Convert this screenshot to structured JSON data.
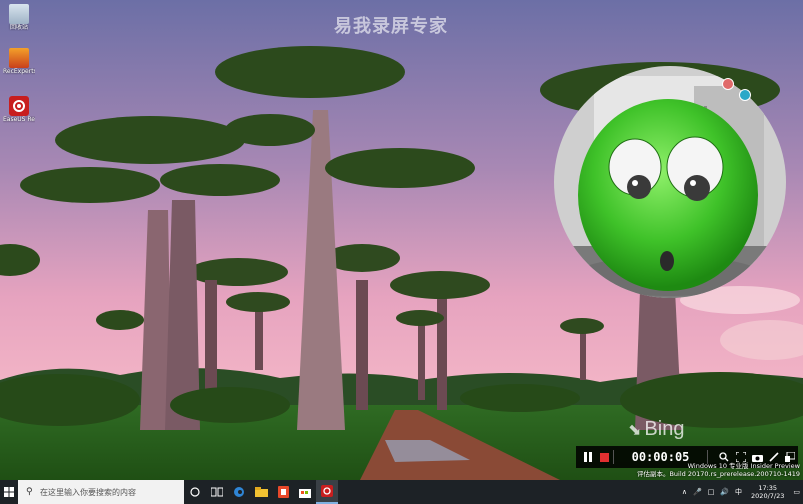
{
  "desktop": {
    "icons": [
      {
        "label": "回收站",
        "icon": "recycle-bin-icon"
      },
      {
        "label": "RecExperts",
        "icon": "box-app-icon"
      },
      {
        "label": "EaseUS RecExperts",
        "icon": "recexperts-icon"
      }
    ],
    "watermark": "易我录屏专家",
    "bing": "Bing"
  },
  "recorder": {
    "timer": "00:00:05",
    "pause_icon": "pause-icon",
    "stop_icon": "stop-icon",
    "accent": "#e03030"
  },
  "windows_watermark": {
    "line1": "Windows 10 专业版 Insider Preview",
    "line2": "评估副本。Build 20170.rs_prerelease.200710-1419"
  },
  "taskbar": {
    "search_placeholder": "在这里输入你要搜索的内容",
    "time": "17:35",
    "date": "2020/7/23",
    "ime": "中"
  }
}
